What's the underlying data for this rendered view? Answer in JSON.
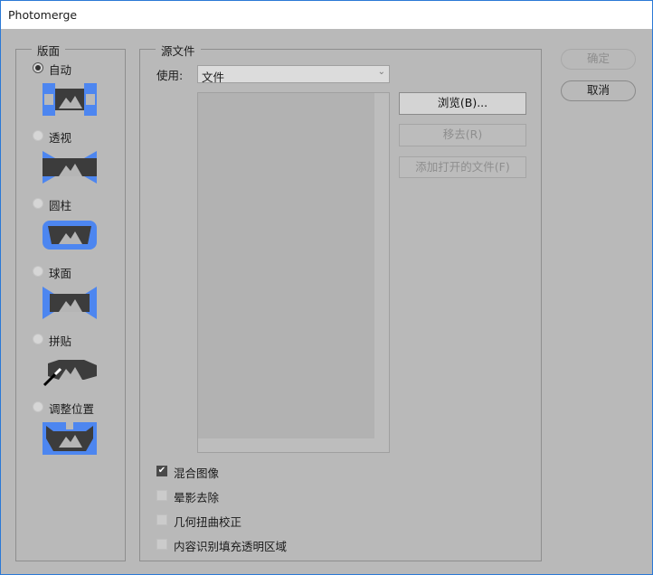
{
  "window": {
    "title": "Photomerge"
  },
  "layout_group": {
    "title": "版面",
    "options": [
      {
        "label": "自动",
        "selected": true,
        "icon": "auto-layout-icon"
      },
      {
        "label": "透视",
        "selected": false,
        "icon": "perspective-layout-icon"
      },
      {
        "label": "圆柱",
        "selected": false,
        "icon": "cylindrical-layout-icon"
      },
      {
        "label": "球面",
        "selected": false,
        "icon": "spherical-layout-icon"
      },
      {
        "label": "拼贴",
        "selected": false,
        "icon": "collage-layout-icon"
      },
      {
        "label": "调整位置",
        "selected": false,
        "icon": "reposition-layout-icon"
      }
    ]
  },
  "source": {
    "title": "源文件",
    "use_label": "使用:",
    "use_value": "文件",
    "browse": "浏览(B)...",
    "remove": "移去(R)",
    "add_open": "添加打开的文件(F)"
  },
  "options": [
    {
      "label": "混合图像",
      "checked": true
    },
    {
      "label": "晕影去除",
      "checked": false
    },
    {
      "label": "几何扭曲校正",
      "checked": false
    },
    {
      "label": "内容识别填充透明区域",
      "checked": false
    }
  ],
  "buttons": {
    "ok": "确定",
    "cancel": "取消"
  },
  "colors": {
    "accent": "#4d86f0",
    "icon_dark": "#3c3c3c"
  }
}
